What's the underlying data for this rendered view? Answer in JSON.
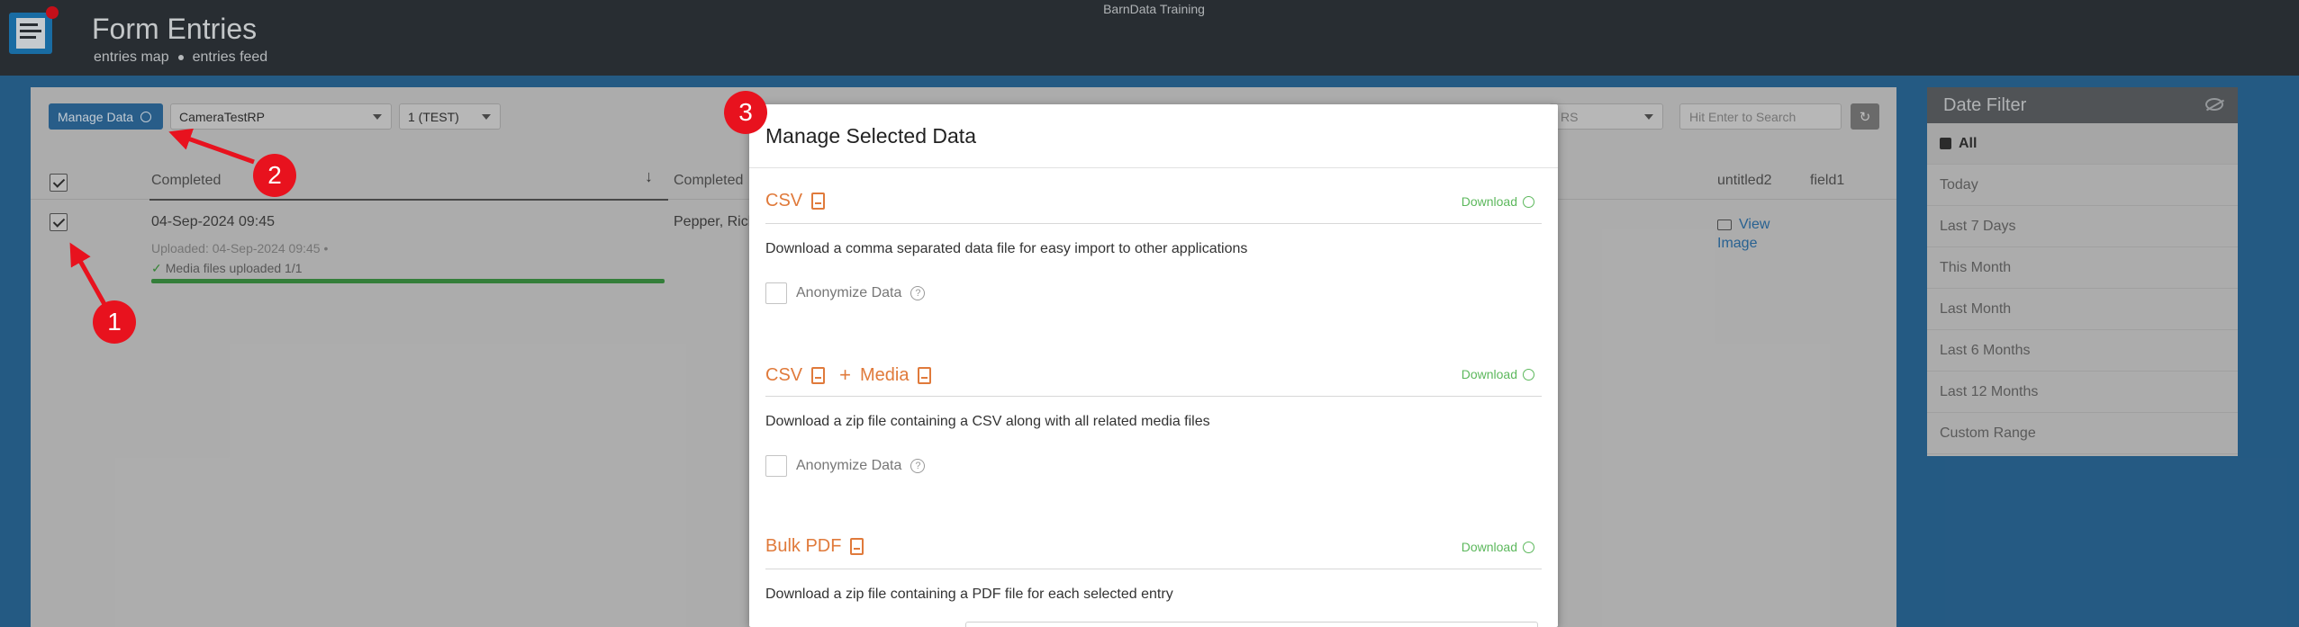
{
  "header": {
    "org_name": "BarnData Training",
    "title": "Form Entries",
    "links": [
      "entries map",
      "entries feed"
    ]
  },
  "toolbar": {
    "manage_label": "Manage Data",
    "form_select": "CameraTestRP",
    "version_select": "1 (TEST)",
    "hidden_select_fragment": "RS",
    "search_placeholder": "Hit Enter to Search"
  },
  "table": {
    "columns": [
      "Completed",
      "Completed",
      "untitled2",
      "field1"
    ],
    "rows": [
      {
        "completed": "04-Sep-2024 09:45",
        "uploaded": "Uploaded: 04-Sep-2024 09:45  •",
        "media": "Media files uploaded 1/1",
        "completed_by": "Pepper, Rich",
        "view_line1": "View",
        "view_line2": "Image"
      }
    ]
  },
  "date_filter": {
    "title": "Date Filter",
    "options": [
      "All",
      "Today",
      "Last 7 Days",
      "This Month",
      "Last Month",
      "Last 6 Months",
      "Last 12 Months",
      "Custom Range"
    ],
    "selected": "All"
  },
  "modal": {
    "title": "Manage Selected Data",
    "sections": [
      {
        "title": "CSV",
        "download": "Download",
        "desc": "Download a comma separated data file for easy import to other applications",
        "anonymize": "Anonymize Data"
      },
      {
        "title": "CSV",
        "title_extra": "Media",
        "download": "Download",
        "desc": "Download a zip file containing a CSV along with all related media files",
        "anonymize": "Anonymize Data"
      },
      {
        "title": "Bulk PDF",
        "download": "Download",
        "desc": "Download a zip file containing a PDF file for each selected entry"
      }
    ]
  },
  "annotations": {
    "markers": [
      "1",
      "2",
      "3"
    ],
    "color": "#e8121e"
  },
  "colors": {
    "accent_orange": "#e07a3b",
    "download_green": "#5cb85c",
    "primary_blue": "#2f6ea1",
    "header_dark": "#2f363b"
  }
}
